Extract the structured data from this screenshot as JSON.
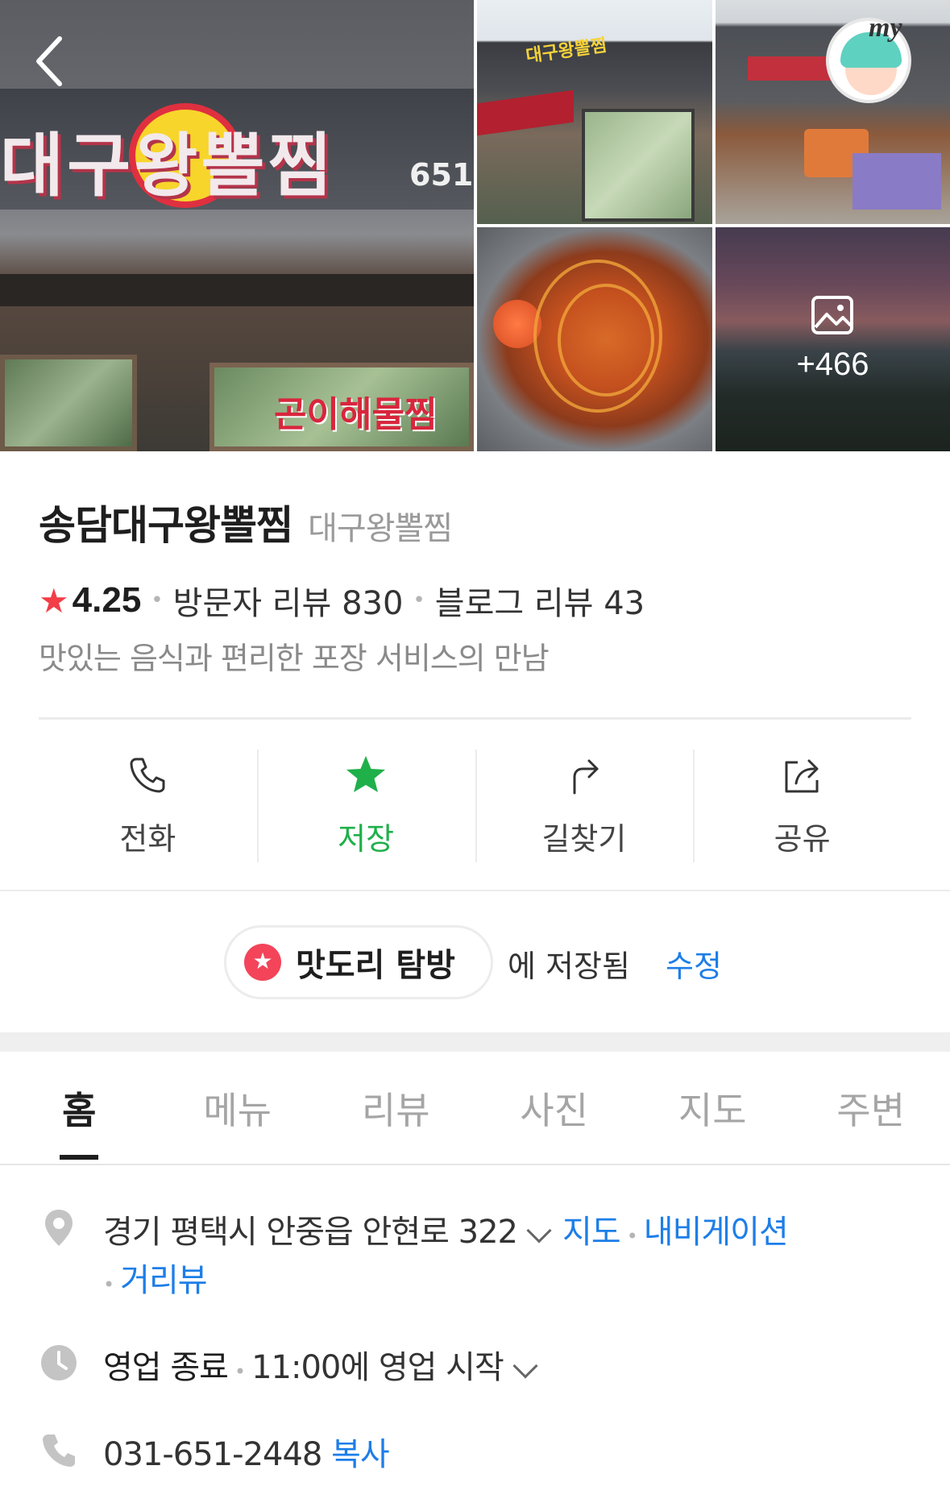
{
  "gallery": {
    "main_sign_text": "대구왕뽈찜",
    "main_sign_number": "651",
    "main_window_sign": "곤이해물찜",
    "more_photos_label": "+466"
  },
  "header": {
    "my_label": "my"
  },
  "place": {
    "name": "송담대구왕뽈찜",
    "category": "대구왕뽈찜",
    "rating": "4.25",
    "visitor_reviews": "방문자 리뷰 830",
    "blog_reviews": "블로그 리뷰 43",
    "description": "맛있는 음식과 편리한 포장 서비스의 만남"
  },
  "actions": [
    {
      "label": "전화",
      "icon": "phone-icon"
    },
    {
      "label": "저장",
      "icon": "star-icon"
    },
    {
      "label": "길찾기",
      "icon": "directions-icon"
    },
    {
      "label": "공유",
      "icon": "share-icon"
    }
  ],
  "saved": {
    "list_name": "맛도리 탐방",
    "suffix": "에 저장됨",
    "edit_label": "수정"
  },
  "tabs": [
    "홈",
    "메뉴",
    "리뷰",
    "사진",
    "지도",
    "주변"
  ],
  "details": {
    "address": "경기 평택시 안중읍 안현로 322",
    "map_link": "지도",
    "navigation_link": "내비게이션",
    "streetview_link": "거리뷰",
    "hours_status": "영업 종료",
    "hours_next": "11:00에 영업 시작",
    "phone": "031-651-2448",
    "copy_label": "복사"
  },
  "colors": {
    "accent_green": "#1fb04a",
    "link_blue": "#1d7ee8",
    "rating_star": "#f33d47",
    "saved_pill_icon": "#f3445a"
  }
}
